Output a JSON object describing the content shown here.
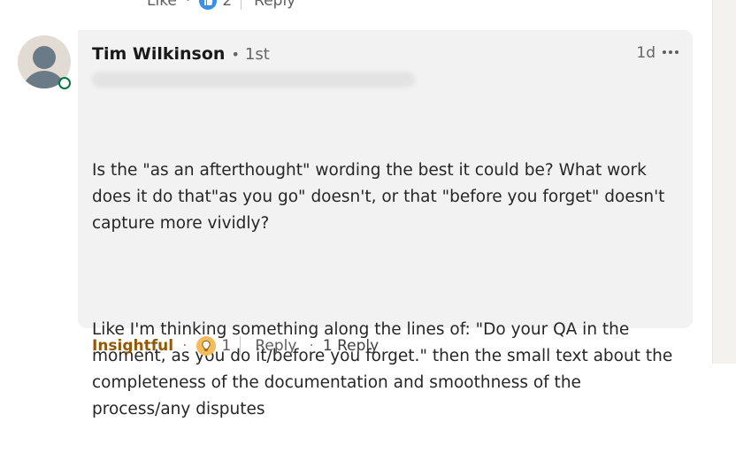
{
  "previous_comment": {
    "like_label": "Like",
    "separator": "·",
    "reaction_count": "2",
    "reply_label": "Reply"
  },
  "comment": {
    "author_name": "Tim Wilkinson",
    "author_separator": "•",
    "connection_degree": "1st",
    "timestamp": "1d",
    "paragraphs": [
      "Is the \"as an afterthought\" wording the best it could be? What work does it do that\"as you go\" doesn't, or that \"before you forget\" doesn't capture more vividly?",
      "Like I'm thinking something along the lines of: \"Do your QA in the moment, as you do it/before you forget.\" then the small text about the completeness of the documentation and smoothness of the process/any disputes"
    ]
  },
  "actions": {
    "reaction_label": "Insightful",
    "separator": "·",
    "reaction_count": "1",
    "reply_label": "Reply",
    "replies_separator": "·",
    "replies_label": "1 Reply"
  },
  "icons": {
    "like_badge": "thumbs-up-icon",
    "insightful_badge": "lightbulb-icon",
    "more": "more-options-icon",
    "avatar": "default-avatar-icon",
    "presence": "online-status-icon"
  },
  "colors": {
    "bubble_bg": "#f2f2f2",
    "insightful": "#915907",
    "like_blue": "#378fe9",
    "bulb_yellow": "#f5bb5c",
    "presence_green": "#057642"
  }
}
